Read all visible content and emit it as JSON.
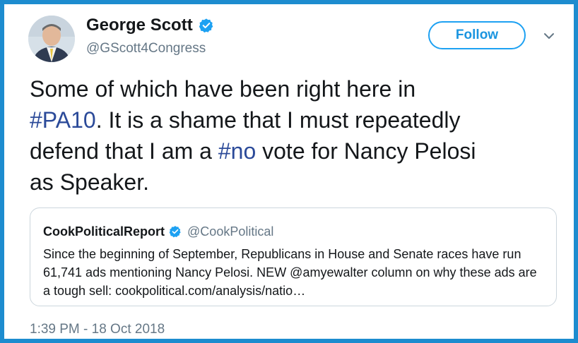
{
  "author": {
    "display_name": "George Scott",
    "handle": "@GScott4Congress"
  },
  "follow_button": {
    "label": "Follow"
  },
  "tweet": {
    "line1": "Some of which have been right here in",
    "hashtag1": "#PA10",
    "line2_rest": ". It is a shame that I must repeatedly",
    "line3_start": "defend that I am a ",
    "hashtag2": "#no",
    "line3_rest": " vote for Nancy Pelosi",
    "line4": "as Speaker."
  },
  "quote": {
    "display_name": "CookPoliticalReport",
    "handle": "@CookPolitical",
    "text": "Since the beginning of September, Republicans in House and Senate races have run 61,741 ads mentioning Nancy Pelosi. NEW @amyewalter column on why these ads are a tough sell: cookpolitical.com/analysis/natio…"
  },
  "timestamp": "1:39 PM - 18 Oct 2018",
  "colors": {
    "frame_border": "#1d8ccf",
    "link_blue": "#1da1f2",
    "hashtag": "#2b4a99",
    "muted_text": "#657786"
  },
  "icons": {
    "verified": "verified-badge-icon",
    "more": "chevron-down-icon"
  }
}
